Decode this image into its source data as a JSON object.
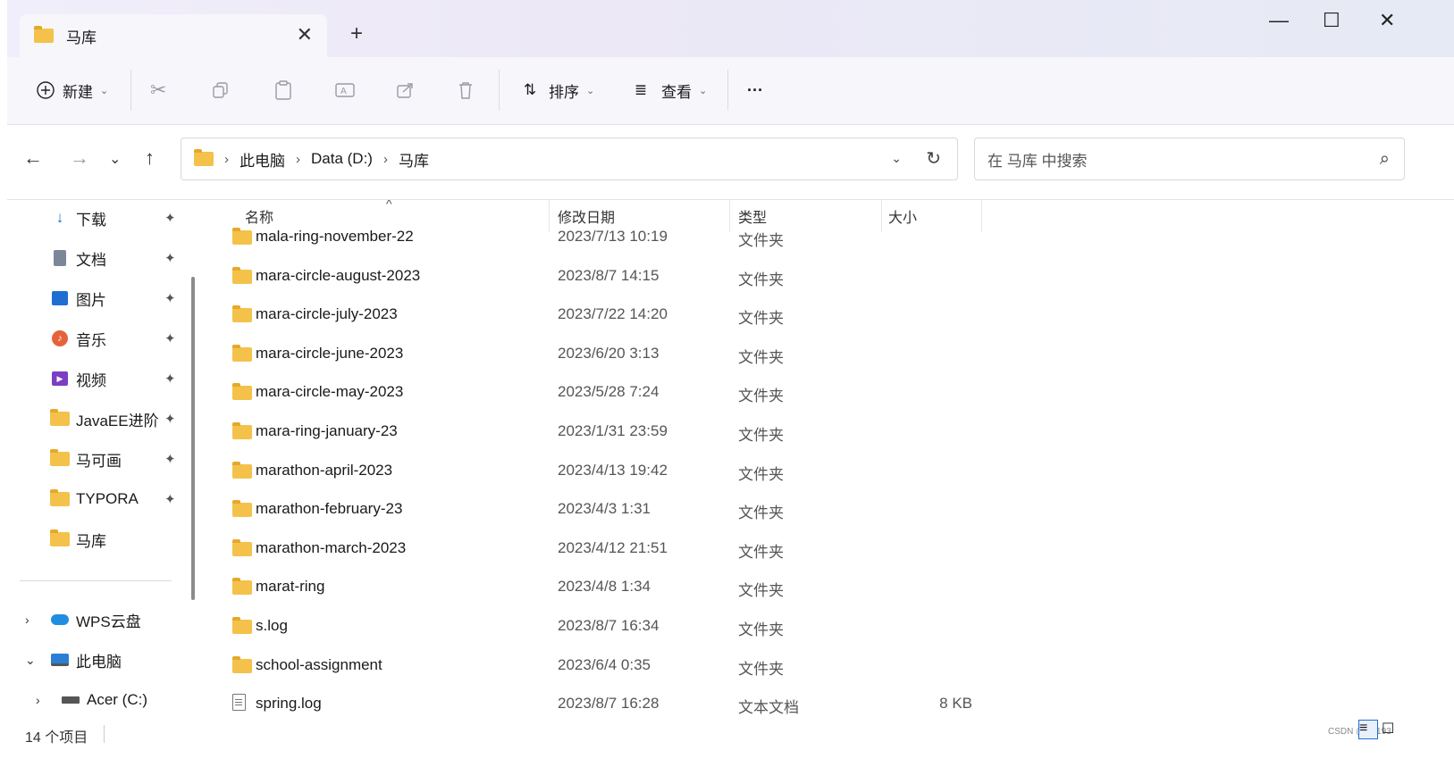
{
  "tab": {
    "title": "马库",
    "close": "✕",
    "new_tab": "+"
  },
  "window": {
    "minimize": "—",
    "maximize": "☐",
    "close": "✕"
  },
  "toolbar": {
    "new_label": "新建",
    "sort_label": "排序",
    "view_label": "查看",
    "more_label": "···"
  },
  "nav": {
    "back": "←",
    "forward": "→",
    "recent": "⌄",
    "up": "↑"
  },
  "address": {
    "segments": [
      "此电脑",
      "Data (D:)",
      "马库"
    ],
    "separator": "›"
  },
  "search": {
    "placeholder": "在 马库 中搜索"
  },
  "sidebar": {
    "quick_access": [
      {
        "label": "下载",
        "icon": "download-icon"
      },
      {
        "label": "文档",
        "icon": "document-icon"
      },
      {
        "label": "图片",
        "icon": "pictures-icon"
      },
      {
        "label": "音乐",
        "icon": "music-icon"
      },
      {
        "label": "视频",
        "icon": "video-icon"
      },
      {
        "label": "JavaEE进阶",
        "icon": "folder-icon"
      },
      {
        "label": "马可画",
        "icon": "folder-icon"
      },
      {
        "label": "TYPORA",
        "icon": "folder-icon"
      },
      {
        "label": "马库",
        "icon": "folder-icon"
      }
    ],
    "tree": [
      {
        "label": "WPS云盘",
        "icon": "cloud-icon",
        "chevron": "›"
      },
      {
        "label": "此电脑",
        "icon": "computer-icon",
        "chevron": "⌄"
      },
      {
        "label": "Acer (C:)",
        "icon": "drive-icon",
        "chevron": "›"
      }
    ]
  },
  "columns": {
    "name": "名称",
    "modified": "修改日期",
    "type": "类型",
    "size": "大小"
  },
  "files": [
    {
      "name": "mala-ring-november-22",
      "modified": "2023/7/13 10:19",
      "type": "文件夹",
      "size": "",
      "kind": "folder"
    },
    {
      "name": "mara-circle-august-2023",
      "modified": "2023/8/7 14:15",
      "type": "文件夹",
      "size": "",
      "kind": "folder"
    },
    {
      "name": "mara-circle-july-2023",
      "modified": "2023/7/22 14:20",
      "type": "文件夹",
      "size": "",
      "kind": "folder"
    },
    {
      "name": "mara-circle-june-2023",
      "modified": "2023/6/20 3:13",
      "type": "文件夹",
      "size": "",
      "kind": "folder"
    },
    {
      "name": "mara-circle-may-2023",
      "modified": "2023/5/28 7:24",
      "type": "文件夹",
      "size": "",
      "kind": "folder"
    },
    {
      "name": "mara-ring-january-23",
      "modified": "2023/1/31 23:59",
      "type": "文件夹",
      "size": "",
      "kind": "folder"
    },
    {
      "name": "marathon-april-2023",
      "modified": "2023/4/13 19:42",
      "type": "文件夹",
      "size": "",
      "kind": "folder"
    },
    {
      "name": "marathon-february-23",
      "modified": "2023/4/3 1:31",
      "type": "文件夹",
      "size": "",
      "kind": "folder"
    },
    {
      "name": "marathon-march-2023",
      "modified": "2023/4/12 21:51",
      "type": "文件夹",
      "size": "",
      "kind": "folder"
    },
    {
      "name": "marat-ring",
      "modified": "2023/4/8 1:34",
      "type": "文件夹",
      "size": "",
      "kind": "folder"
    },
    {
      "name": "s.log",
      "modified": "2023/8/7 16:34",
      "type": "文件夹",
      "size": "",
      "kind": "folder"
    },
    {
      "name": "school-assignment",
      "modified": "2023/6/4 0:35",
      "type": "文件夹",
      "size": "",
      "kind": "folder"
    },
    {
      "name": "spring.log",
      "modified": "2023/8/7 16:28",
      "type": "文本文档",
      "size": "8 KB",
      "kind": "text"
    }
  ],
  "status": {
    "item_count": "14 个项目",
    "watermark": "CSDN @吕t193"
  },
  "colors": {
    "folder": "#f4c24a",
    "titlebar": "#ece8f6",
    "toolbar": "#f7f6fb",
    "accent": "#1f6fd1"
  }
}
